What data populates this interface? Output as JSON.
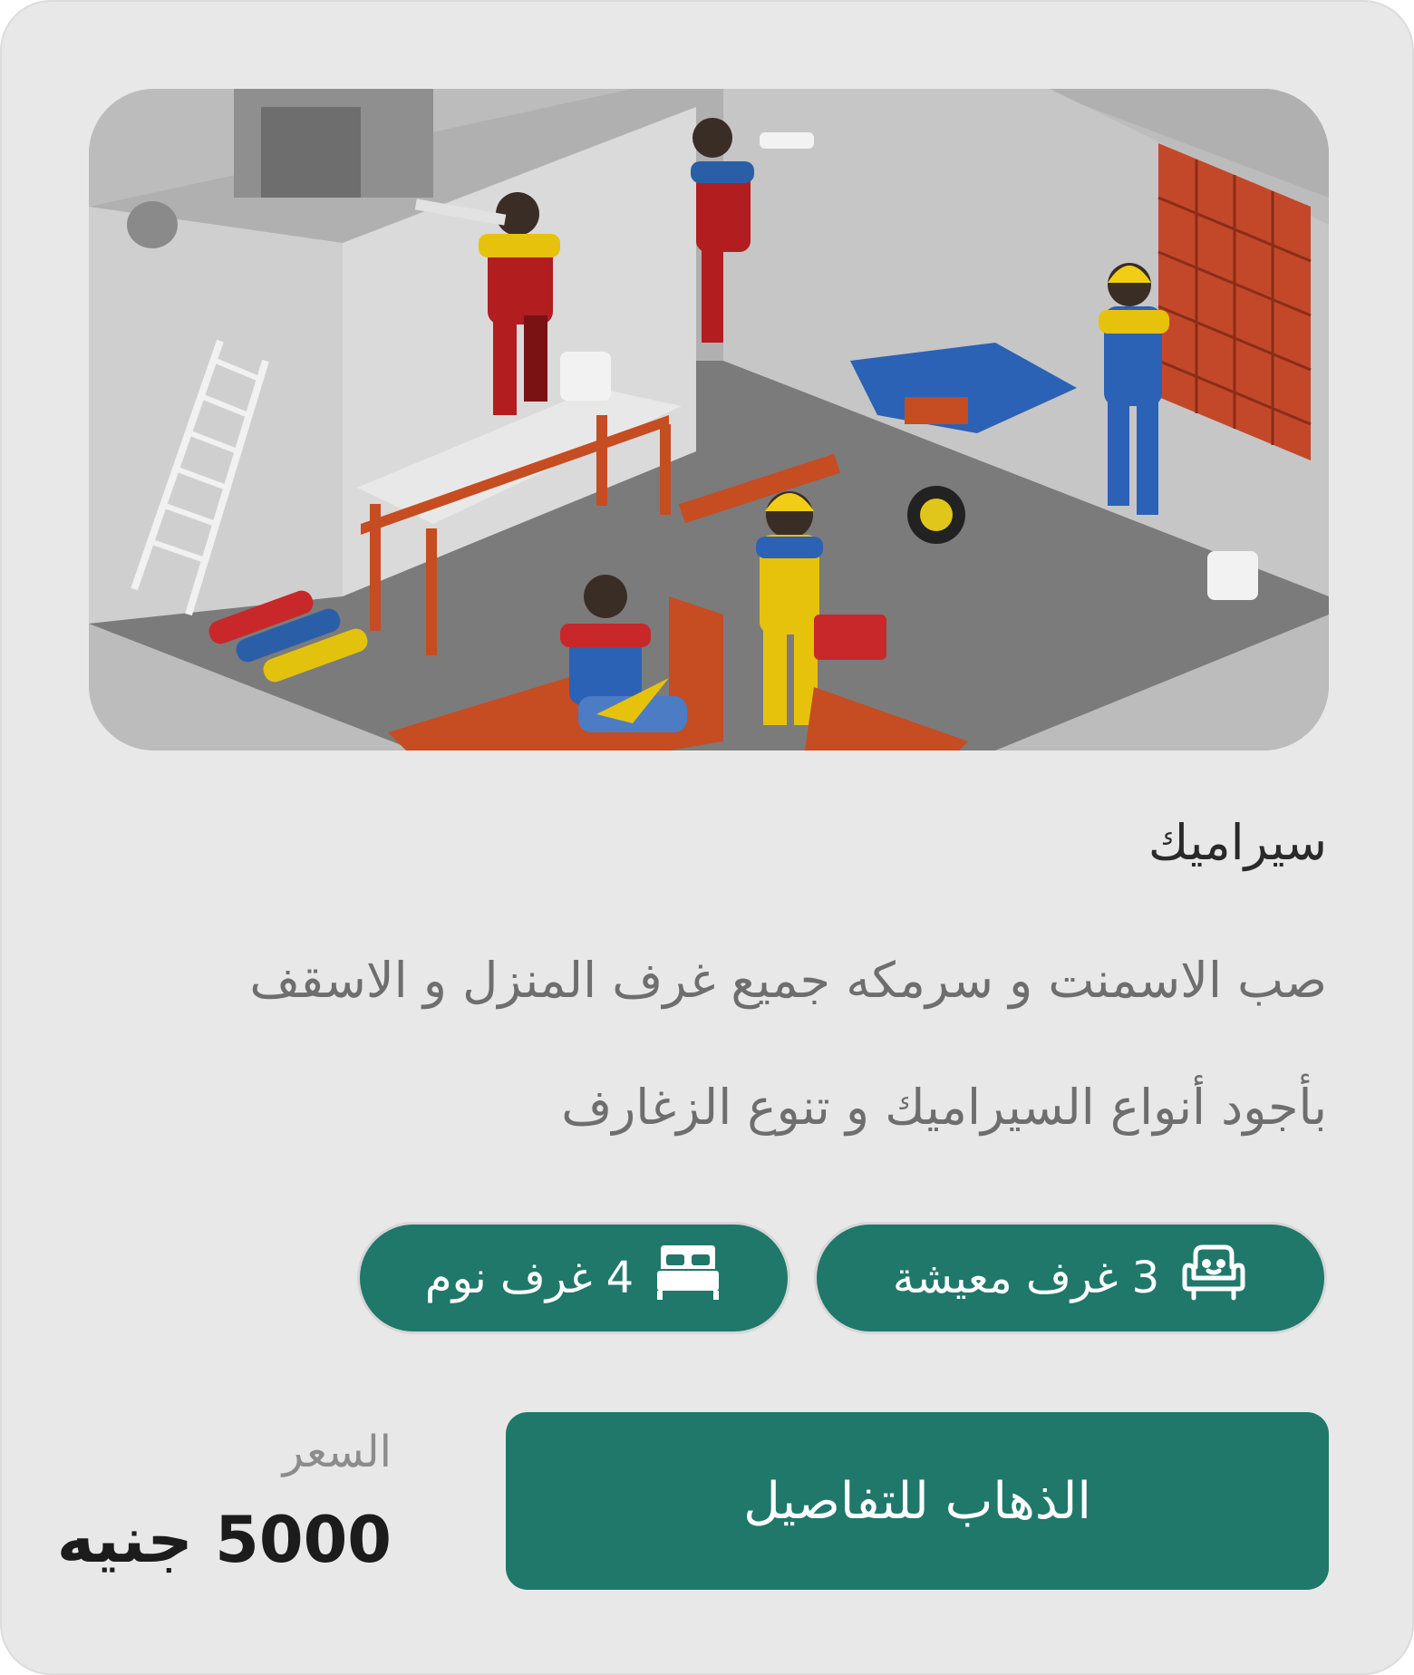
{
  "card": {
    "image_alt": "renovation-workers-illustration",
    "title": "سيراميك",
    "description_lines": [
      "صب الاسمنت و سرمكه جميع غرف المنزل و الاسقف",
      "بأجود أنواع السيراميك و تنوع الزغارف"
    ],
    "features": {
      "living": {
        "icon": "sofa-icon",
        "label": "3 غرف معيشة"
      },
      "bed": {
        "icon": "bed-icon",
        "label": "4 غرف نوم"
      }
    },
    "details_button": "الذهاب للتفاصيل",
    "price_label": "السعر",
    "price_value": "5000 جنيه"
  },
  "colors": {
    "card_bg": "#e8e8e8",
    "accent": "#1f786a",
    "title_text": "#2a2a2a",
    "desc_text": "#6e6e6e",
    "price_label": "#8c8c8c"
  }
}
